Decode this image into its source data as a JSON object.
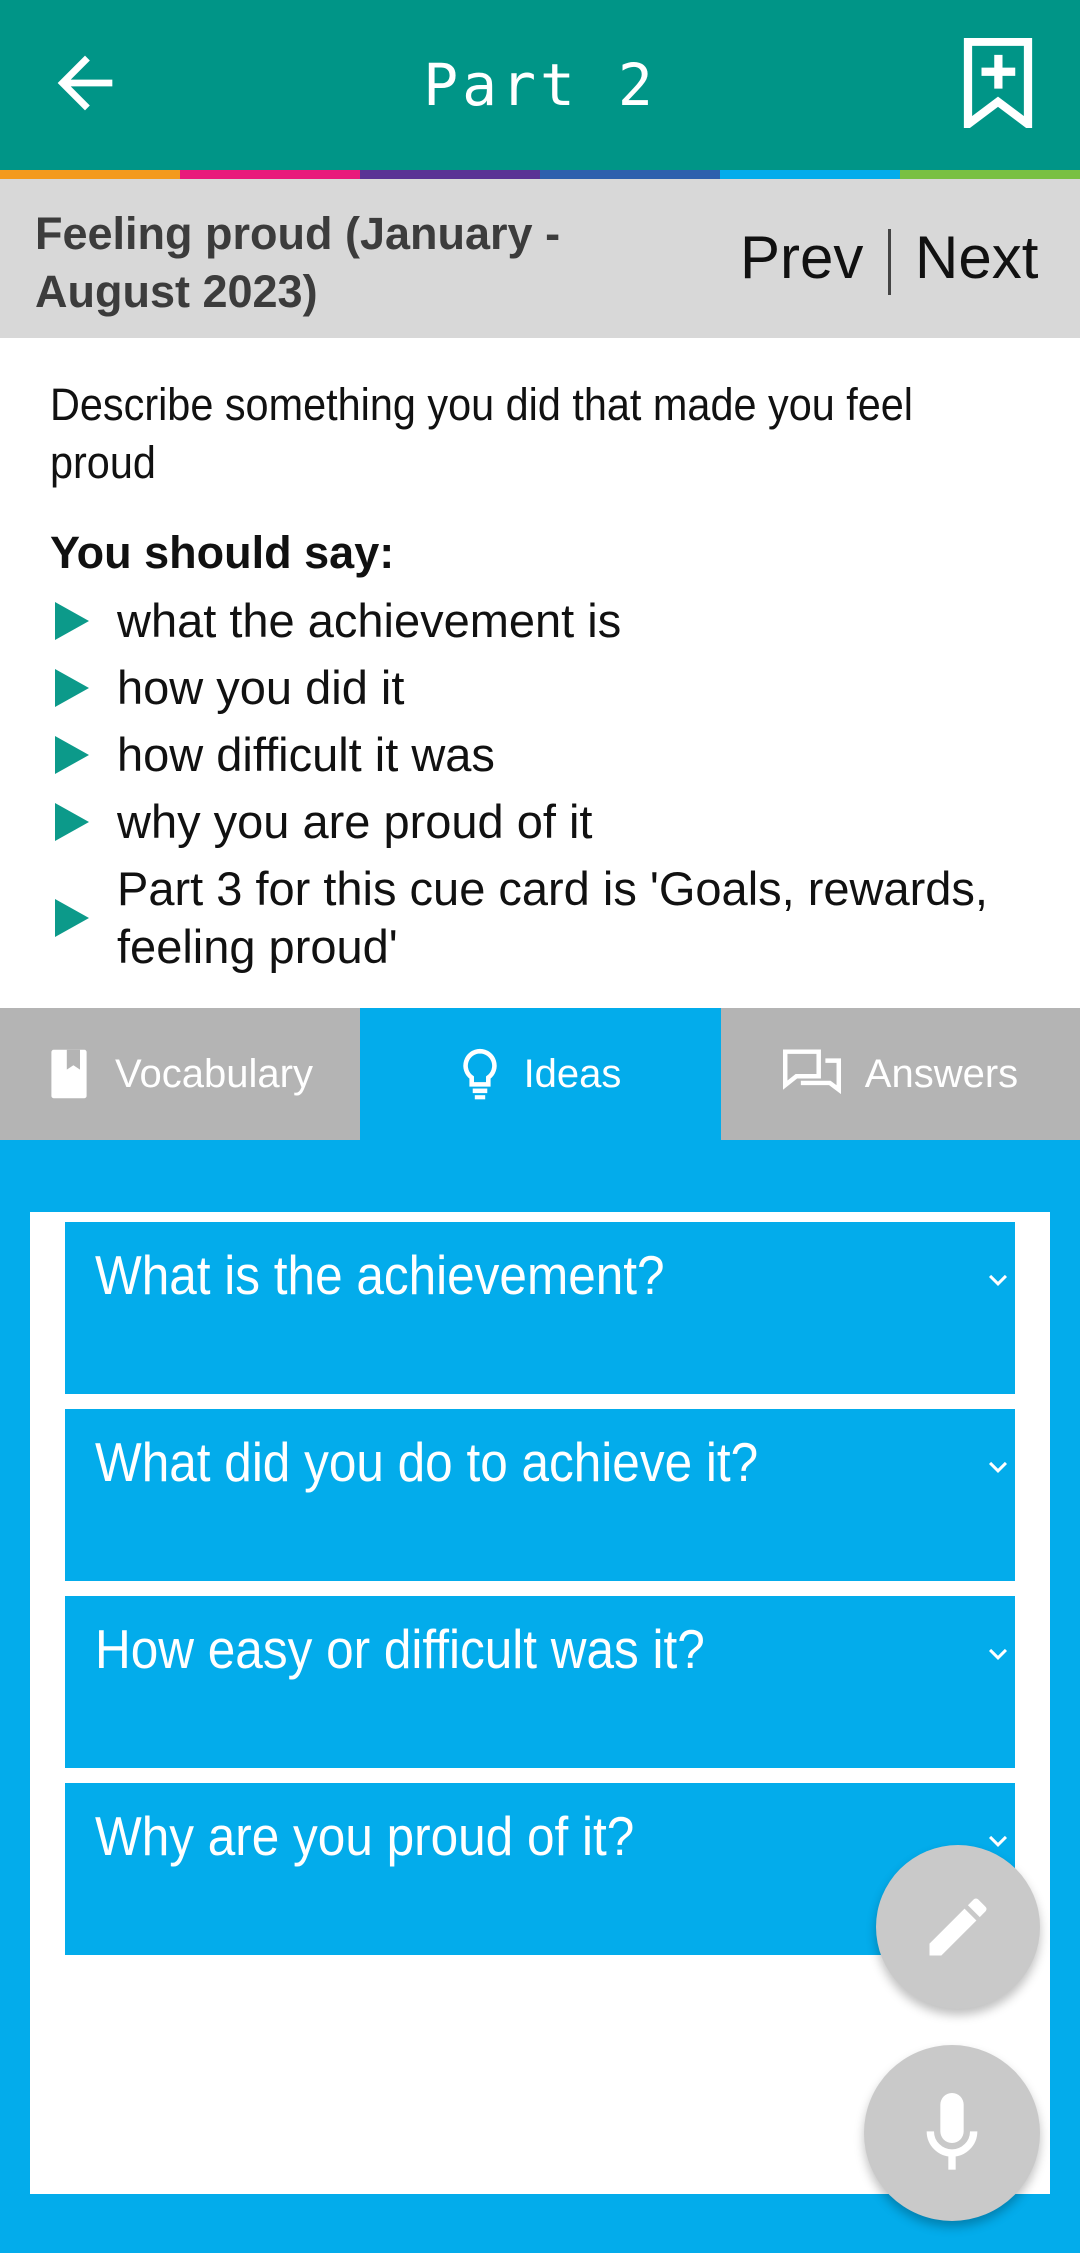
{
  "appbar": {
    "title": "Part 2",
    "back_icon": "arrow-back-icon",
    "bookmark_icon": "bookmark-add-icon",
    "color": "#009587"
  },
  "color_strip": [
    "#f39a1e",
    "#e9197b",
    "#5a3295",
    "#2e60ad",
    "#03aceb",
    "#79c043"
  ],
  "topic": {
    "title": "Feeling proud (January - August 2023)",
    "prev_label": "Prev",
    "next_label": "Next"
  },
  "cue_card": {
    "prompt": "Describe something you did that made you feel proud",
    "should_say": "You should say:",
    "bullets": [
      "what the achievement is",
      "how you did it",
      "how difficult it was",
      "why you are proud of it",
      "Part 3 for this cue card is 'Goals, rewards, feeling proud'"
    ]
  },
  "tabs": [
    {
      "label": "Vocabulary",
      "icon": "book-icon",
      "selected": false
    },
    {
      "label": "Ideas",
      "icon": "lightbulb-icon",
      "selected": true
    },
    {
      "label": "Answers",
      "icon": "chat-bubbles-icon",
      "selected": false
    }
  ],
  "questions": [
    "What is the achievement?",
    "What did you do to achieve it?",
    "How easy or difficult was it?",
    "Why are you proud of it?"
  ],
  "fabs": {
    "edit_icon": "pencil-icon",
    "mic_icon": "microphone-icon"
  },
  "colors": {
    "accent_blue": "#03aceb",
    "bullet_teal": "#0c9a8a",
    "tab_inactive": "#b4b4b4"
  }
}
